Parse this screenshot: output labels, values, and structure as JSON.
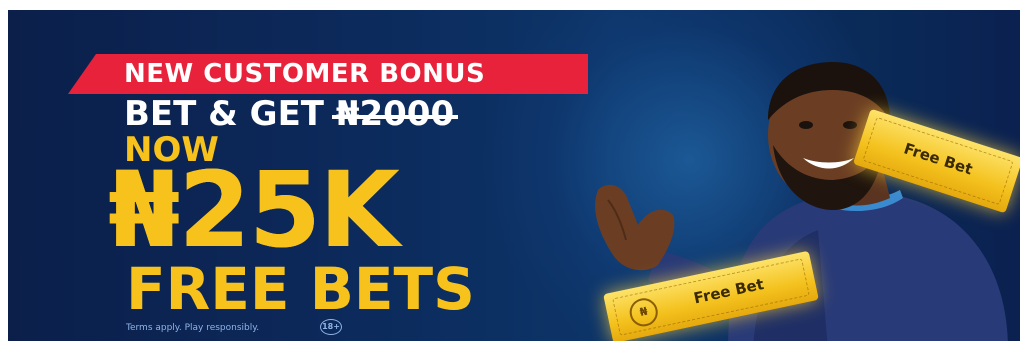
{
  "banner": {
    "ribbon_text": "NEW CUSTOMER BONUS",
    "bet_get_prefix": "BET & GET ",
    "old_amount": "₦2000",
    "now_text": "NOW",
    "amount_text": "₦25K",
    "free_bets_text": "FREE BETS",
    "terms_text": "Terms apply. Play responsibly.",
    "age_badge": "18+"
  },
  "tickets": [
    {
      "label": "Free Bet"
    },
    {
      "label": "Free Bet",
      "coin": "₦"
    }
  ],
  "colors": {
    "background": "#0c2a5c",
    "ribbon": "#e8223a",
    "accent_yellow": "#f7c21c",
    "text_white": "#ffffff"
  }
}
